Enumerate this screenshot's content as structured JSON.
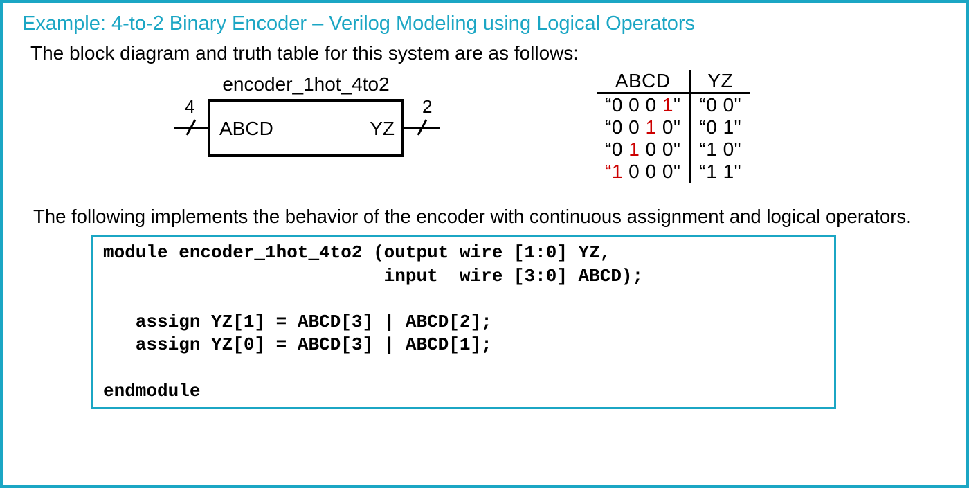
{
  "title": "Example: 4-to-2 Binary Encoder – Verilog Modeling using Logical Operators",
  "intro": "The block diagram and truth table for this system are as follows:",
  "moduleLabel": "encoder_1hot_4to2",
  "port": {
    "inName": "ABCD",
    "inWidth": "4",
    "outName": "YZ",
    "outWidth": "2"
  },
  "truth": {
    "hdr_in": "ABCD",
    "hdr_out": "YZ",
    "rows": [
      {
        "in_pre": "“0 0 0 ",
        "in_hot": "1",
        "in_post": "\"",
        "out": "“0 0\""
      },
      {
        "in_pre": "“0 0 ",
        "in_hot": "1",
        "in_post": " 0\"",
        "out": "“0 1\""
      },
      {
        "in_pre": "“0 ",
        "in_hot": "1",
        "in_post": " 0 0\"",
        "out": "“1 0\""
      },
      {
        "in_pre": "“",
        "in_hot": "1",
        "in_post": " 0 0 0\"",
        "out": "“1 1\""
      }
    ]
  },
  "follow": "The following implements the behavior of the encoder with continuous assignment and logical operators.",
  "code": "module encoder_1hot_4to2 (output wire [1:0] YZ,\n                          input  wire [3:0] ABCD);\n\n   assign YZ[1] = ABCD[3] | ABCD[2];\n   assign YZ[0] = ABCD[3] | ABCD[1];\n\nendmodule"
}
